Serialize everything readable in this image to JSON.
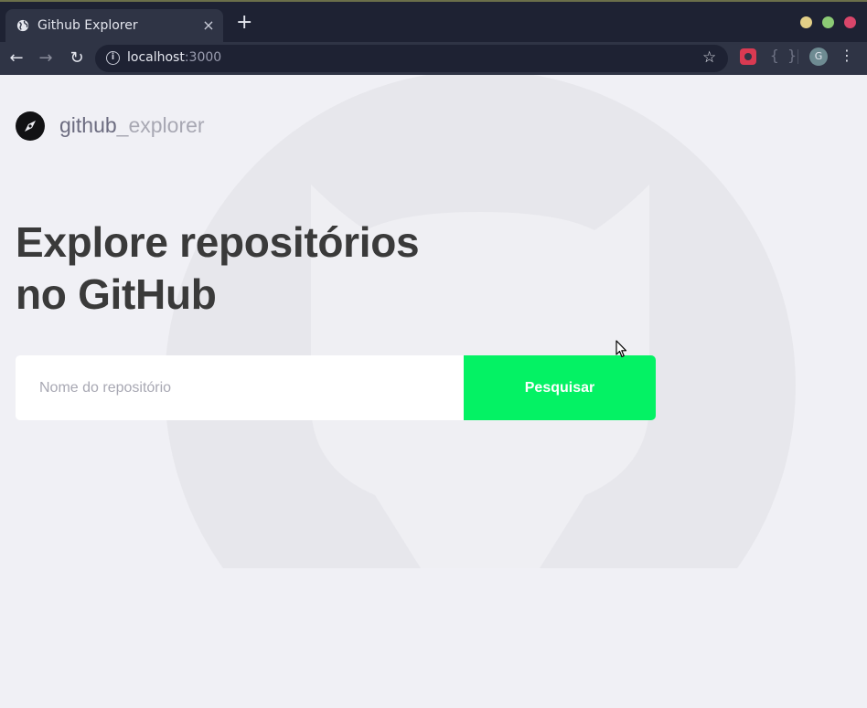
{
  "browser": {
    "tab_title": "Github Explorer",
    "close_glyph": "×",
    "new_tab_glyph": "+",
    "url_host": "localhost",
    "url_port": ":3000",
    "avatar_letter": "G",
    "braces": "{ }",
    "icons": [
      "globe-icon",
      "close-icon",
      "plus-icon",
      "back-icon",
      "forward-icon",
      "reload-icon",
      "info-icon",
      "star-icon",
      "extension-icon",
      "braces-icon",
      "profile-avatar",
      "menu-icon"
    ]
  },
  "page": {
    "logo_strong": "github",
    "logo_light": "_explorer",
    "headline_line1": "Explore repositórios",
    "headline_line2": "no GitHub",
    "search_placeholder": "Nome do repositório",
    "search_value": "",
    "search_button": "Pesquisar"
  },
  "colors": {
    "accent": "#04f264",
    "headline": "#3a3a3a",
    "background": "#f0f0f5",
    "chrome_dark": "#1e2233",
    "chrome_toolbar": "#2f3445"
  }
}
